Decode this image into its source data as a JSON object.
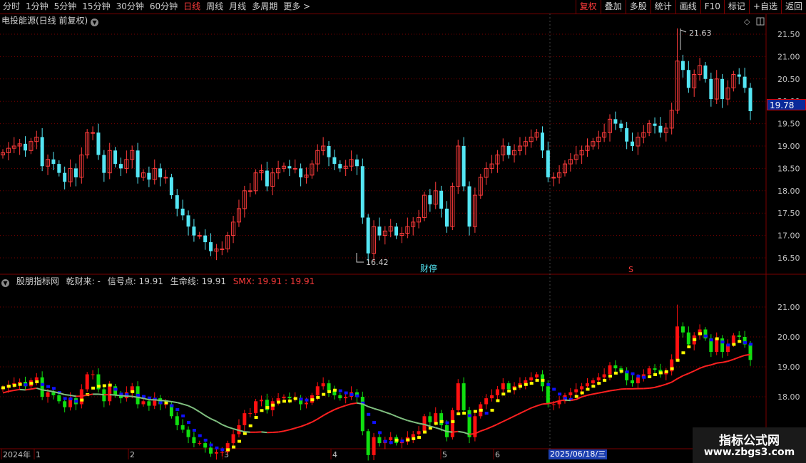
{
  "toolbar": {
    "periods": [
      "分时",
      "1分钟",
      "5分钟",
      "15分钟",
      "30分钟",
      "60分钟",
      "日线",
      "周线",
      "月线",
      "多周期",
      "更多 >"
    ],
    "active_period": "日线",
    "right_buttons": [
      "复权",
      "叠加",
      "多股",
      "统计",
      "画线",
      "F10",
      "标记",
      "+自选",
      "返回"
    ],
    "active_button": "复权"
  },
  "main": {
    "title": "电投能源(日线 前复权)",
    "price_axis": [
      "21.50",
      "21.00",
      "20.50",
      "20.00",
      "19.50",
      "19.00",
      "18.50",
      "18.00",
      "17.50",
      "17.00",
      "16.50"
    ],
    "current_price_label": "19.78",
    "high_label": "21.63",
    "low_label": "16.42",
    "event_label": "财停",
    "s_marker": "S",
    "colors": {
      "up": "#ff3b3b",
      "down": "#54e6f4",
      "grid": "#7a0000"
    }
  },
  "indicator": {
    "name": "股朋指标网",
    "qiancai": "乾财来: -",
    "signal": "信号点: 19.91",
    "lifeline": "生命线: 19.91",
    "smx": "SMX: 19.91 : 19.91",
    "axis": [
      "21.00",
      "20.00",
      "19.00",
      "18.00"
    ],
    "colors": {
      "up": "#ff1010",
      "down": "#10e010",
      "signal_up": "#ffff00",
      "signal_down": "#1010ff",
      "smx_up": "#ff2020",
      "smx_down": "#80c080"
    }
  },
  "date_axis": {
    "labels": [
      "2024年",
      "1",
      "2",
      "3",
      "4",
      "5",
      "6"
    ],
    "cursor_date": "2025/06/18/三"
  },
  "watermark": {
    "line1": "指标公式网",
    "line2": "www.zbgs3.com"
  },
  "chart_data": {
    "type": "candlestick",
    "title": "电投能源(日线 前复权)",
    "price_range": [
      16.3,
      21.8
    ],
    "indicator_range": [
      17.3,
      22.0
    ],
    "high": 21.63,
    "low": 16.42,
    "close_last": 19.78,
    "closes": [
      18.85,
      18.95,
      19.0,
      19.05,
      18.9,
      19.1,
      19.2,
      18.55,
      18.7,
      18.6,
      18.4,
      18.2,
      18.5,
      18.3,
      18.8,
      19.3,
      19.3,
      18.8,
      18.4,
      18.9,
      18.6,
      18.5,
      18.7,
      18.9,
      18.3,
      18.4,
      18.25,
      18.5,
      18.3,
      18.3,
      17.9,
      17.6,
      17.45,
      17.2,
      17.0,
      17.0,
      16.85,
      16.65,
      16.7,
      16.7,
      17.0,
      17.3,
      17.6,
      18.0,
      18.0,
      18.4,
      18.45,
      18.1,
      18.4,
      18.5,
      18.55,
      18.5,
      18.5,
      18.3,
      18.35,
      18.6,
      18.9,
      19.0,
      18.75,
      18.6,
      18.5,
      18.55,
      18.7,
      18.55,
      17.4,
      16.6,
      17.2,
      17.0,
      17.1,
      17.2,
      17.0,
      17.05,
      17.2,
      17.3,
      17.4,
      17.9,
      17.7,
      18.0,
      17.6,
      17.2,
      18.1,
      19.0,
      18.1,
      17.2,
      17.9,
      18.3,
      18.5,
      18.6,
      18.8,
      19.0,
      18.8,
      18.9,
      19.0,
      19.1,
      19.2,
      19.3,
      18.9,
      18.3,
      18.3,
      18.4,
      18.6,
      18.7,
      18.8,
      18.9,
      19.0,
      19.1,
      19.2,
      19.3,
      19.6,
      19.5,
      19.4,
      19.1,
      19.0,
      19.2,
      19.3,
      19.5,
      19.45,
      19.3,
      19.4,
      19.8,
      20.9,
      20.7,
      20.3,
      20.6,
      20.8,
      20.5,
      20.05,
      20.5,
      20.05,
      20.3,
      20.6,
      20.55,
      20.3,
      19.78
    ]
  }
}
